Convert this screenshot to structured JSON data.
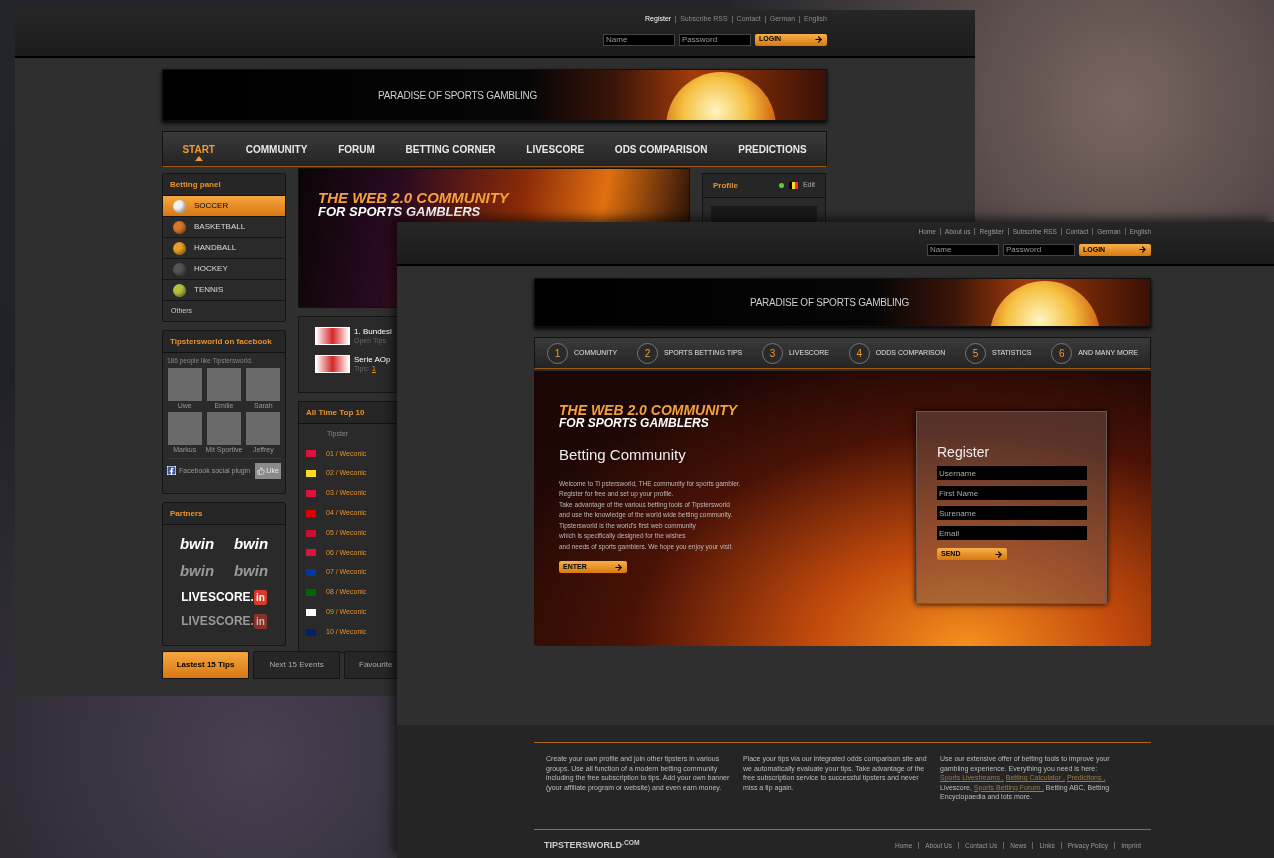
{
  "back_page": {
    "top_links": [
      {
        "label": "Register",
        "selected": true
      },
      {
        "label": "Subscribe RSS",
        "selected": false
      },
      {
        "label": "Contact",
        "selected": false
      },
      {
        "label": "German",
        "selected": false
      },
      {
        "label": "English",
        "selected": false
      }
    ],
    "login": {
      "name_placeholder": "Name",
      "password_placeholder": "Password",
      "button": "LOGIN"
    },
    "banner_title": "PARADISE OF SPORTS GAMBLING",
    "nav": [
      {
        "label": "START",
        "selected": true
      },
      {
        "label": "COMMUNITY",
        "selected": false
      },
      {
        "label": "FORUM",
        "selected": false
      },
      {
        "label": "BETTING CORNER",
        "selected": false
      },
      {
        "label": "LIVESCORE",
        "selected": false
      },
      {
        "label": "ODS COMPARISON",
        "selected": false
      },
      {
        "label": "PREDICTIONS",
        "selected": false
      }
    ],
    "betting_panel": {
      "title": "Betting panel",
      "sports": [
        {
          "label": "SOCCER",
          "selected": true,
          "color": "#f2f2f2"
        },
        {
          "label": "BASKETBALL",
          "selected": false,
          "color": "#d9782a"
        },
        {
          "label": "HANDBALL",
          "selected": false,
          "color": "#e8a020"
        },
        {
          "label": "HOCKEY",
          "selected": false,
          "color": "#555555"
        },
        {
          "label": "TENNIS",
          "selected": false,
          "color": "#b8c040"
        }
      ],
      "others": "Others"
    },
    "facebook": {
      "title": "Tipstersworld on facebook",
      "likes": "186 people like Tipstersworld.",
      "fans": [
        {
          "name": "Uwe"
        },
        {
          "name": "Emilie"
        },
        {
          "name": "Sarah"
        },
        {
          "name": "Markus"
        },
        {
          "name": "Mit Sportive"
        },
        {
          "name": "Jeffrey"
        }
      ],
      "plugin": "Facebook social plugin",
      "like_button": "Like"
    },
    "partners": {
      "title": "Partners",
      "logos": [
        {
          "kind": "bwin",
          "label": "bwin",
          "dim": false
        },
        {
          "kind": "bwin",
          "label": "bwin",
          "dim": false
        },
        {
          "kind": "bwin",
          "label": "bwin",
          "dim": true
        },
        {
          "kind": "bwin",
          "label": "bwin",
          "dim": true
        },
        {
          "kind": "livescore",
          "label": "LIVESCORE.",
          "badge": "in",
          "dim": false
        },
        {
          "kind": "livescore",
          "label": "LIVESCORE.",
          "badge": "in",
          "dim": true
        }
      ]
    },
    "hero": {
      "headline": "THE WEB 2.0 COMMUNITY",
      "subline": "FOR SPORTS GAMBLERS"
    },
    "leagues": [
      {
        "name": "1. Bundesl",
        "meta_label": "Open Tips"
      },
      {
        "name": "Serie AOp",
        "meta_label": "Tips:",
        "meta_value": "1"
      }
    ],
    "top10": {
      "title": "All Time Top 10",
      "column_1": "Tipster",
      "rows": [
        {
          "entry": "01 / Weconic",
          "color": "#dc143c"
        },
        {
          "entry": "02 / Weconic",
          "color": "#fdda24"
        },
        {
          "entry": "03 / Weconic",
          "color": "#dc143c"
        },
        {
          "entry": "04 / Weconic",
          "color": "#dd0000"
        },
        {
          "entry": "05 / Weconic",
          "color": "#c8102e"
        },
        {
          "entry": "06 / Weconic",
          "color": "#dc143c"
        },
        {
          "entry": "07 / Weconic",
          "color": "#0039a6"
        },
        {
          "entry": "08 / Weconic",
          "color": "#006600"
        },
        {
          "entry": "09 / Weconic",
          "color": "#ffffff"
        },
        {
          "entry": "10 / Weconic",
          "color": "#012169"
        }
      ]
    },
    "profile": {
      "title": "Profile",
      "status": {
        "color": "#66cc33"
      },
      "edit": "Edit"
    },
    "tabs": [
      {
        "label": "Lastest 15 Tips",
        "selected": true
      },
      {
        "label": "Next 15 Events",
        "selected": false
      },
      {
        "label": "Favourite",
        "selected": false
      }
    ]
  },
  "front_page": {
    "top_links": [
      "Home",
      "About us",
      "Register",
      "Subscribe RSS",
      "Contact",
      "German",
      "English"
    ],
    "login": {
      "name_placeholder": "Name",
      "password_placeholder": "Password",
      "button": "LOGIN"
    },
    "banner_title": "PARADISE OF SPORTS GAMBLING",
    "nav": [
      {
        "number": "1",
        "label": "COMMUNITY"
      },
      {
        "number": "2",
        "label": "SPORTS BETTING TIPS"
      },
      {
        "number": "3",
        "label": "LIVESCORE"
      },
      {
        "number": "4",
        "label": "ODDS COMPARISON"
      },
      {
        "number": "5",
        "label": "STATISTICS"
      },
      {
        "number": "6",
        "label": "AND MANY MORE"
      }
    ],
    "hero": {
      "headline": "THE WEB 2.0 COMMUNITY",
      "subline": "FOR SPORTS GAMBLERS",
      "title": "Betting Community",
      "body": [
        "Welcome to Ti pstersworld, THE community for sports gambler.",
        "Register for free and set up your profile.",
        "Take advantage of the various betting tools of Tipstersworld",
        "and use the knowledge of the world wide betting community.",
        "Tipstersworld is the world's first web community",
        "which is specifically designed for the wishes",
        "and needs of sports gamblers. We hope you enjoy your visit."
      ],
      "enter_button": "ENTER"
    },
    "register": {
      "title": "Register",
      "fields": [
        {
          "placeholder": "Username"
        },
        {
          "placeholder": "First Name"
        },
        {
          "placeholder": "Surename"
        },
        {
          "placeholder": "Email"
        }
      ],
      "button": "SEND"
    },
    "footer_columns": [
      [
        {
          "kind": "text",
          "text": "Create your own profile and join other tipsters in various groups. Use all function of a modern betting community including the free subscription to tips. Add your own banner (your affiliate program or website) and even earn money."
        }
      ],
      [
        {
          "kind": "text",
          "text": "Place your tips via our integrated odds comparison site and we automatically evaluate your tips. Take advantage of the free subscription service to successful tipsters and never miss a tip again."
        }
      ],
      [
        {
          "kind": "text",
          "text": "Use our extensive offer of betting tools to improve your gambling experience. Everything you need is here: "
        },
        {
          "kind": "link",
          "text": "Sports Livestreams ,"
        },
        {
          "kind": "text",
          "text": " "
        },
        {
          "kind": "link",
          "text": "Betting Calculator ,"
        },
        {
          "kind": "text",
          "text": " "
        },
        {
          "kind": "link",
          "text": "Predicitons ,"
        },
        {
          "kind": "text",
          "text": " Livescore, "
        },
        {
          "kind": "link",
          "text": "Sports Betting Forum ,"
        },
        {
          "kind": "text",
          "text": " Betting ABC, Betting Encyclopaedia and lots more."
        }
      ]
    ],
    "logo": "TIPSTERS**WORLD**$^{.COM}$",
    "bottom_links": [
      "Home",
      "About Us",
      "Contact Us",
      "News",
      "Links",
      "Privacy Policy",
      "Imprint"
    ]
  }
}
